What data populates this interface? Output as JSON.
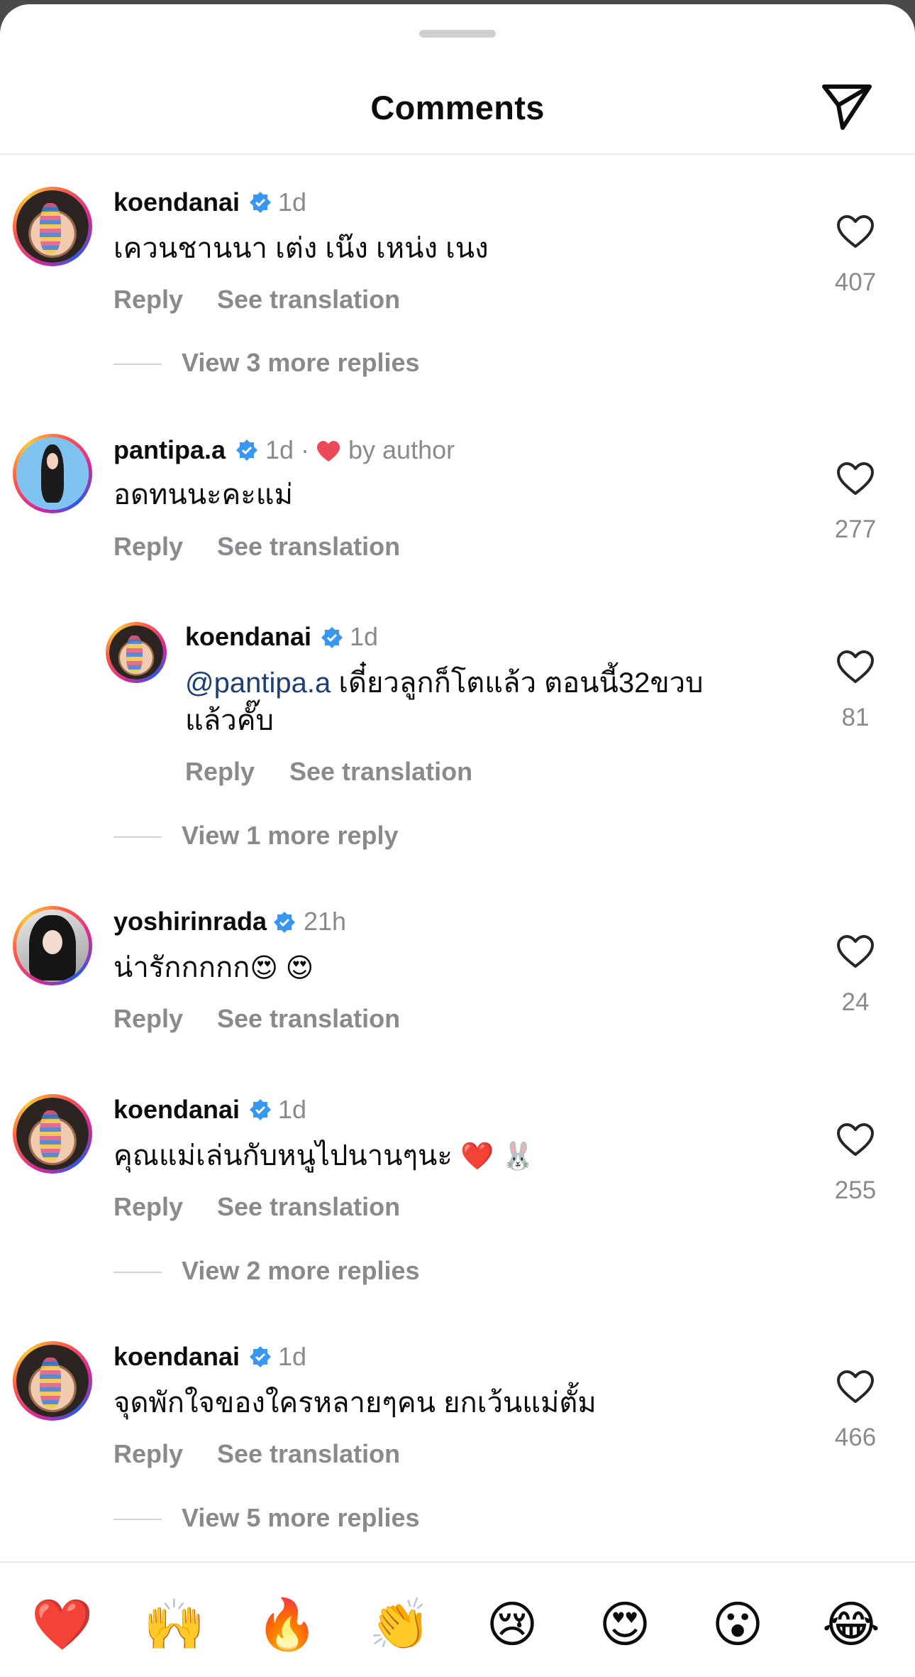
{
  "header": {
    "title": "Comments",
    "share_icon": "paper-plane-icon"
  },
  "comments": [
    {
      "username": "koendanai",
      "verified": true,
      "time": "1d",
      "text": "เควนชานนา เต่ง เน๊ง เหน่ง เนง",
      "reply": "Reply",
      "see_translation": "See translation",
      "likes": "407",
      "more_replies": "View 3 more replies"
    },
    {
      "username": "pantipa.a",
      "verified": true,
      "time": "1d ·",
      "by_author": "by author",
      "text": "อดทนนะคะแม่",
      "reply": "Reply",
      "see_translation": "See translation",
      "likes": "277"
    },
    {
      "username": "koendanai",
      "verified": true,
      "time": "1d",
      "mention": "@pantipa.a",
      "text": " เดี๋ยวลูกก็โตแล้ว ตอนนี้32ขวบ",
      "text_line2": "แล้วคั๊บ",
      "reply": "Reply",
      "see_translation": "See translation",
      "likes": "81",
      "more_replies": "View 1 more reply"
    },
    {
      "username": "yoshirinrada",
      "verified": true,
      "time": "21h",
      "text": "น่ารักกกกก",
      "emojis": "😍 😍",
      "reply": "Reply",
      "see_translation": "See translation",
      "likes": "24"
    },
    {
      "username": "koendanai",
      "verified": true,
      "time": "1d",
      "text": "คุณแม่เล่นกับหนูไปนานๆนะ",
      "emojis": "❤️ 🐰",
      "reply": "Reply",
      "see_translation": "See translation",
      "likes": "255",
      "more_replies": "View 2 more replies"
    },
    {
      "username": "koendanai",
      "verified": true,
      "time": "1d",
      "text": "จุดพักใจของใครหลายๆคน ยกเว้นแม่ตั้ม",
      "reply": "Reply",
      "see_translation": "See translation",
      "likes": "466",
      "more_replies": "View 5 more replies"
    }
  ],
  "quick_reactions": [
    "❤️",
    "🙌",
    "🔥",
    "👏",
    "😢",
    "😍",
    "😮",
    "😂"
  ],
  "colors": {
    "verified": "#3897f0",
    "author_heart": "#ed4956",
    "secondary_text": "#8a8a8e",
    "mention": "#1e3f74"
  }
}
